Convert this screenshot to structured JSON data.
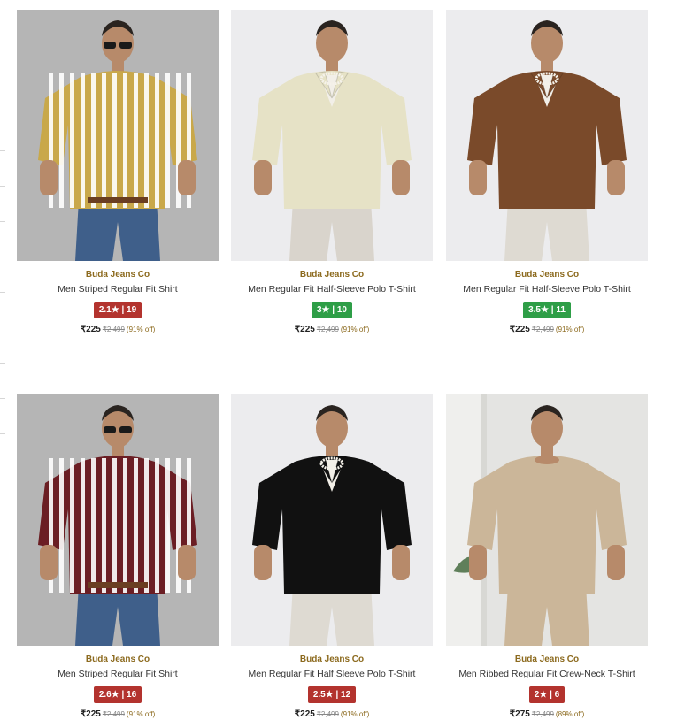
{
  "products": [
    {
      "brand": "Buda Jeans Co",
      "title": "Men Striped Regular Fit Shirt",
      "rating": "2.1★ | 19",
      "rating_color": "#b3332e",
      "price": "₹225",
      "mrp": "₹2,499",
      "discount": "(91% off)",
      "bg": "#b5b5b5",
      "shirt": "#c9a84a",
      "stripe": "#ffffff",
      "style": "striped",
      "pants": "#3f5f8a"
    },
    {
      "brand": "Buda Jeans Co",
      "title": "Men Regular Fit Half-Sleeve Polo T-Shirt",
      "rating": "3★ | 10",
      "rating_color": "#2e9e47",
      "price": "₹225",
      "mrp": "₹2,499",
      "discount": "(91% off)",
      "bg": "#ececee",
      "shirt": "#e6e2c6",
      "stripe": "",
      "style": "polo",
      "pants": "#d9d4cc"
    },
    {
      "brand": "Buda Jeans Co",
      "title": "Men Regular Fit Half-Sleeve Polo T-Shirt",
      "rating": "3.5★ | 11",
      "rating_color": "#2e9e47",
      "price": "₹225",
      "mrp": "₹2,499",
      "discount": "(91% off)",
      "bg": "#ececee",
      "shirt": "#7a4a2a",
      "stripe": "",
      "style": "polo",
      "pants": "#dedad2"
    },
    {
      "brand": "Buda Jeans Co",
      "title": "Men Striped Regular Fit Shirt",
      "rating": "2.6★ | 16",
      "rating_color": "#b3332e",
      "price": "₹225",
      "mrp": "₹2,499",
      "discount": "(91% off)",
      "bg": "#b5b5b5",
      "shirt": "#6b1e24",
      "stripe": "#ffffff",
      "style": "striped",
      "pants": "#3f5f8a"
    },
    {
      "brand": "Buda Jeans Co",
      "title": "Men Regular Fit Half Sleeve Polo T-Shirt",
      "rating": "2.5★ | 12",
      "rating_color": "#b3332e",
      "price": "₹225",
      "mrp": "₹2,499",
      "discount": "(91% off)",
      "bg": "#ececee",
      "shirt": "#111111",
      "stripe": "",
      "style": "polo",
      "pants": "#dedad2"
    },
    {
      "brand": "Buda Jeans Co",
      "title": "Men Ribbed Regular Fit Crew-Neck T-Shirt",
      "rating": "2★ | 6",
      "rating_color": "#b3332e",
      "price": "₹275",
      "mrp": "₹2,499",
      "discount": "(89% off)",
      "bg": "#e4e4e2",
      "shirt": "#cbb699",
      "stripe": "",
      "style": "crew",
      "pants": "#cbb699"
    }
  ]
}
